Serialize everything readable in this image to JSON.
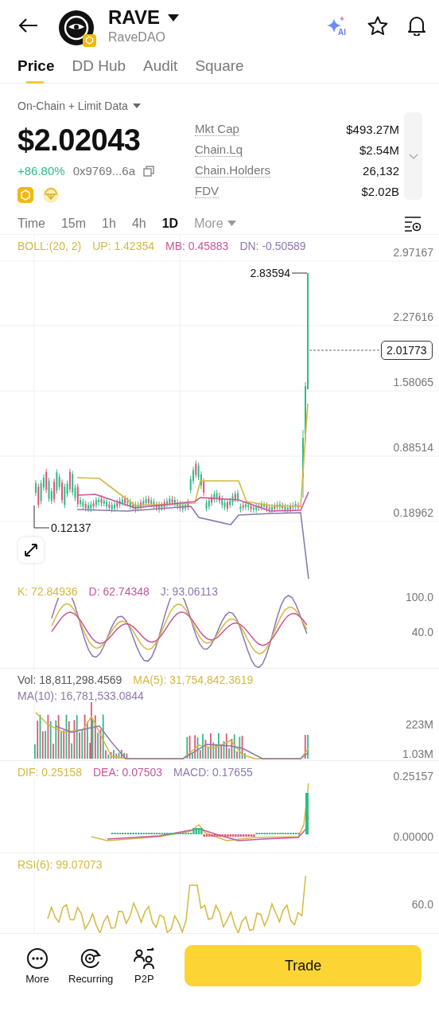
{
  "header": {
    "symbol": "RAVE",
    "name": "RaveDAO",
    "ai_badge": "AI"
  },
  "tabs": [
    {
      "label": "Price",
      "selected": true
    },
    {
      "label": "DD Hub",
      "selected": false
    },
    {
      "label": "Audit",
      "selected": false
    },
    {
      "label": "Square",
      "selected": false
    }
  ],
  "data_source": "On-Chain + Limit Data",
  "quote": {
    "price": "$2.02043",
    "change": "+86.80%",
    "address": "0x9769...6a"
  },
  "stats": [
    {
      "label": "Mkt Cap",
      "value": "$493.27M"
    },
    {
      "label": "Chain.Lq",
      "value": "$2.54M"
    },
    {
      "label": "Chain.Holders",
      "value": "26,132"
    },
    {
      "label": "FDV",
      "value": "$2.02B"
    }
  ],
  "intervals": [
    {
      "label": "Time",
      "selected": false
    },
    {
      "label": "15m",
      "selected": false
    },
    {
      "label": "1h",
      "selected": false
    },
    {
      "label": "4h",
      "selected": false
    },
    {
      "label": "1D",
      "selected": true
    }
  ],
  "interval_menu": "More",
  "main_chart": {
    "legend": [
      {
        "text": "BOLL:(20, 2)",
        "color": "#d4b840"
      },
      {
        "text": "UP: 1.42354",
        "color": "#d4b840"
      },
      {
        "text": "MB: 0.45883",
        "color": "#c8559a"
      },
      {
        "text": "DN: -0.50589",
        "color": "#8c78ad"
      }
    ],
    "axis_labels": [
      "2.97167",
      "2.27616",
      "1.58065",
      "0.88514",
      "0.18962"
    ],
    "high_label": "2.83594",
    "low_label": "0.12137",
    "last_price": "2.01773"
  },
  "kdj": {
    "legend": [
      {
        "text": "K: 72.84936",
        "color": "#d4b840"
      },
      {
        "text": "D: 62.74348",
        "color": "#c8559a"
      },
      {
        "text": "J: 93.06113",
        "color": "#8c78ad"
      }
    ],
    "axis_labels": [
      "100.0",
      "40.0"
    ]
  },
  "volume": {
    "legend": [
      {
        "text": "Vol: 18,811,298.4569",
        "color": "#555555"
      },
      {
        "text": "MA(5): 31,754,842.3619",
        "color": "#d4b840"
      },
      {
        "text": "MA(10): 16,781,533.0844",
        "color": "#8c78ad"
      }
    ],
    "axis_labels": [
      "223M",
      "1.03M"
    ]
  },
  "macd": {
    "legend": [
      {
        "text": "DIF: 0.25158",
        "color": "#d4b840"
      },
      {
        "text": "DEA: 0.07503",
        "color": "#c8559a"
      },
      {
        "text": "MACD: 0.17655",
        "color": "#8c78ad"
      }
    ],
    "axis_labels": [
      "0.25157",
      "0.00000"
    ]
  },
  "rsi": {
    "legend": [
      {
        "text": "RSI(6): 99.07073",
        "color": "#d4b840"
      }
    ],
    "axis_labels": [
      "60.0"
    ]
  },
  "bottom_bar": {
    "actions": [
      {
        "kind": "more",
        "label": "More"
      },
      {
        "kind": "recurring",
        "label": "Recurring"
      },
      {
        "kind": "p2p",
        "label": "P2P"
      }
    ],
    "trade_button": "Trade"
  }
}
